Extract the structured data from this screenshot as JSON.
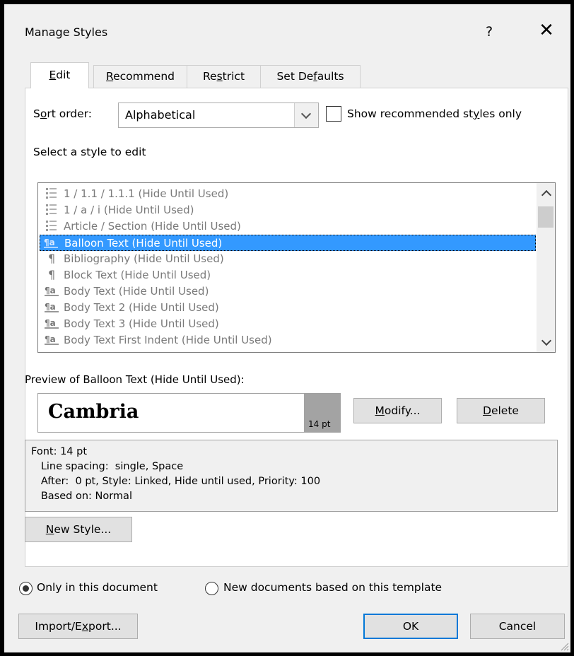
{
  "window": {
    "title": "Manage Styles",
    "help": "?",
    "close": "✕"
  },
  "tabs": [
    {
      "pre": "",
      "key": "E",
      "post": "dit",
      "active": true
    },
    {
      "pre": "",
      "key": "R",
      "post": "ecommend",
      "active": false
    },
    {
      "pre": "Re",
      "key": "s",
      "post": "trict",
      "active": false
    },
    {
      "pre": "Set De",
      "key": "f",
      "post": "aults",
      "active": false
    }
  ],
  "sort": {
    "pre": "S",
    "key": "o",
    "post": "rt order:",
    "value": "Alphabetical"
  },
  "recommended_only": {
    "pre": "Show recommended st",
    "key": "y",
    "post": "les only",
    "checked": false
  },
  "select_label": "Select a style to edit",
  "styles": [
    {
      "icon": "list-style-icon",
      "text": "1 / 1.1 / 1.1.1  (Hide Until Used)",
      "selected": false
    },
    {
      "icon": "list-style-icon",
      "text": "1 / a / i  (Hide Until Used)",
      "selected": false
    },
    {
      "icon": "list-style-icon",
      "text": "Article / Section  (Hide Until Used)",
      "selected": false
    },
    {
      "icon": "linked-style-icon",
      "text": "Balloon Text  (Hide Until Used)",
      "selected": true
    },
    {
      "icon": "paragraph-style-icon",
      "text": "Bibliography  (Hide Until Used)",
      "selected": false
    },
    {
      "icon": "paragraph-style-icon",
      "text": "Block Text  (Hide Until Used)",
      "selected": false
    },
    {
      "icon": "linked-style-icon",
      "text": "Body Text  (Hide Until Used)",
      "selected": false
    },
    {
      "icon": "linked-style-icon",
      "text": "Body Text 2  (Hide Until Used)",
      "selected": false
    },
    {
      "icon": "linked-style-icon",
      "text": "Body Text 3  (Hide Until Used)",
      "selected": false
    },
    {
      "icon": "linked-style-icon",
      "text": "Body Text First Indent  (Hide Until Used)",
      "selected": false
    }
  ],
  "preview": {
    "label": "Preview of Balloon Text  (Hide Until Used):",
    "font": "Cambria",
    "size": "14 pt"
  },
  "buttons": {
    "modify": {
      "key": "M",
      "post": "odify..."
    },
    "delete": {
      "key": "D",
      "post": "elete"
    },
    "new_style": {
      "key": "N",
      "post": "ew Style..."
    },
    "import_export": {
      "pre": "Import/E",
      "key": "x",
      "post": "port..."
    },
    "ok": "OK",
    "cancel": "Cancel"
  },
  "description": [
    "Font: 14 pt",
    "   Line spacing:  single, Space",
    "   After:  0 pt, Style: Linked, Hide until used, Priority: 100",
    "   Based on: Normal"
  ],
  "scope": {
    "only_this": "Only in this document",
    "new_docs": "New documents based on this template",
    "selected": "only_this"
  }
}
